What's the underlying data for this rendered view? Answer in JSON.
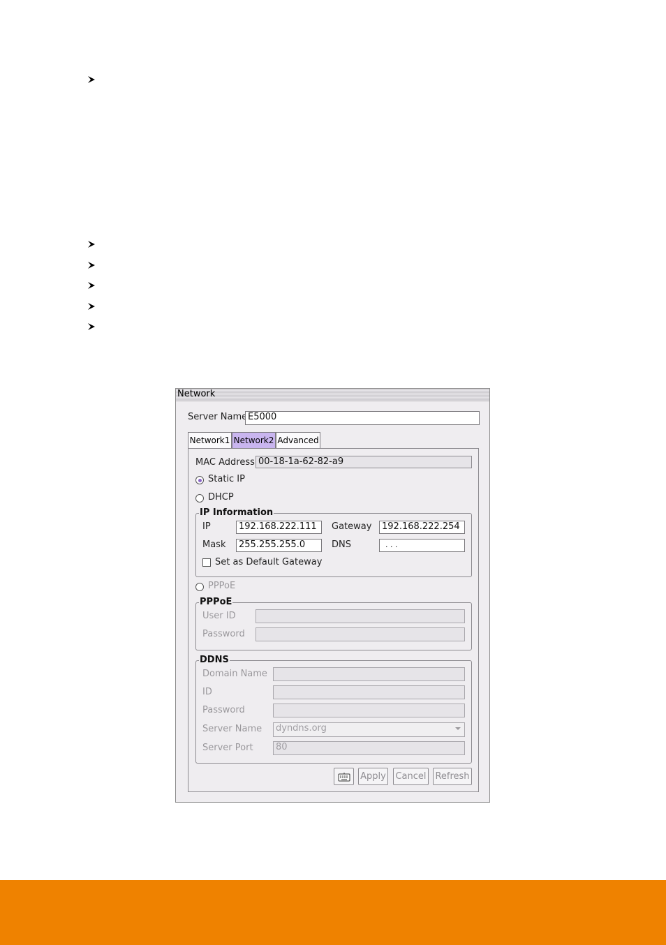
{
  "window": {
    "title": "Network"
  },
  "server_name": {
    "label": "Server Name",
    "value": "E5000"
  },
  "tabs": [
    {
      "label": "Network1",
      "active": false
    },
    {
      "label": "Network2",
      "active": true
    },
    {
      "label": "Advanced",
      "active": false
    }
  ],
  "mac": {
    "label": "MAC Address",
    "value": "00-18-1a-62-82-a9"
  },
  "mode": {
    "static_ip": "Static IP",
    "dhcp": "DHCP",
    "pppoe": "PPPoE",
    "selected": "static_ip"
  },
  "ip_info": {
    "title": "IP Information",
    "ip_label": "IP",
    "ip_value": "192.168.222.111",
    "gateway_label": "Gateway",
    "gateway_value": "192.168.222.254",
    "mask_label": "Mask",
    "mask_value": "255.255.255.0",
    "dns_label": "DNS",
    "dns_value": ".   .   .",
    "default_gateway_label": "Set as Default Gateway"
  },
  "pppoe": {
    "title": "PPPoE",
    "user_id_label": "User ID",
    "user_id_value": "",
    "password_label": "Password",
    "password_value": ""
  },
  "ddns": {
    "title": "DDNS",
    "domain_label": "Domain Name",
    "domain_value": "",
    "id_label": "ID",
    "id_value": "",
    "password_label": "Password",
    "password_value": "",
    "server_name_label": "Server Name",
    "server_name_value": "dyndns.org",
    "server_port_label": "Server Port",
    "server_port_value": "80"
  },
  "buttons": {
    "keyboard_icon": "keyboard-icon",
    "apply": "Apply",
    "cancel": "Cancel",
    "refresh": "Refresh"
  },
  "colors": {
    "footer": "#ef8200",
    "active_tab": "#c9b5ef",
    "radio_dot": "#8a66c9"
  }
}
